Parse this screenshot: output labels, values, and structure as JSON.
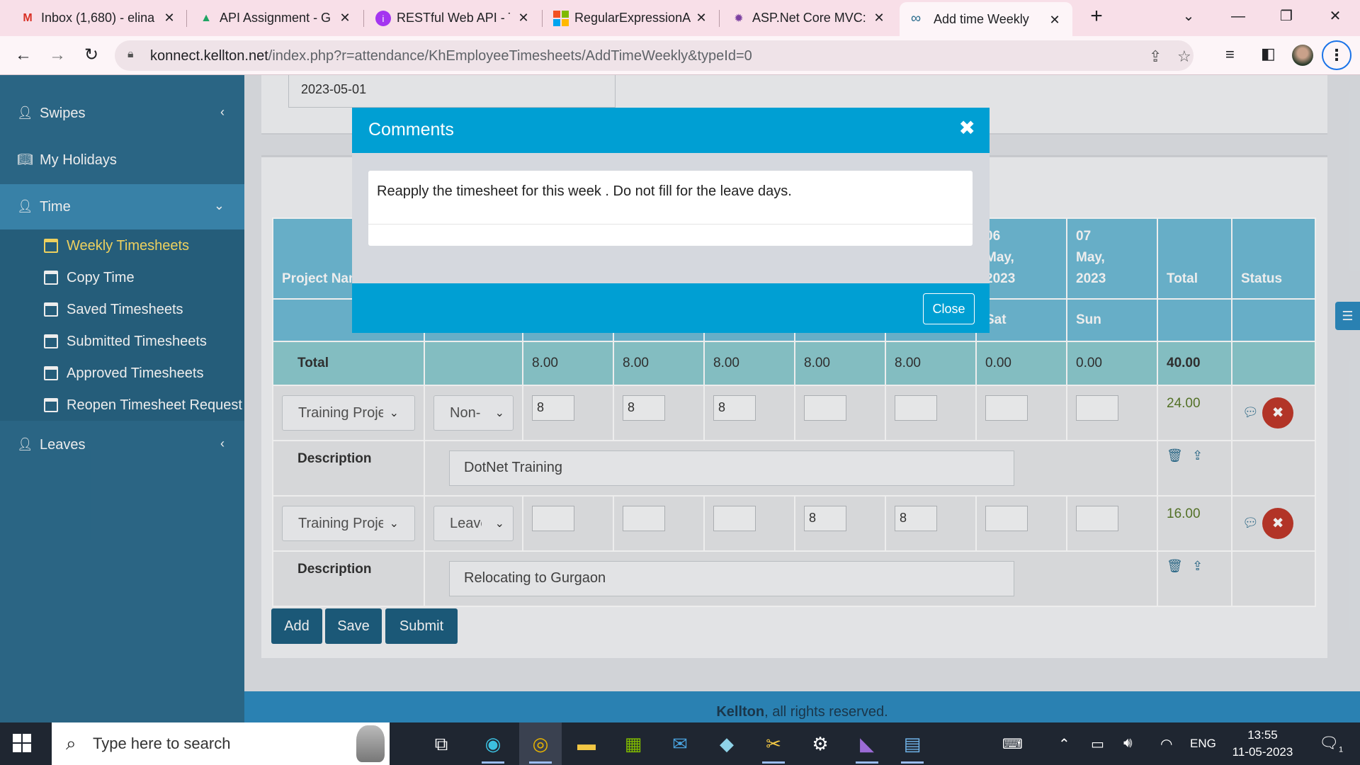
{
  "browser": {
    "tabs": [
      {
        "label": "Inbox (1,680) - elina",
        "icon": "gmail-icon",
        "icon_glyph": "M",
        "icon_color": "#d93025"
      },
      {
        "label": "API Assignment - G",
        "icon": "drive-icon",
        "icon_glyph": "▲",
        "icon_color": "#1fa463"
      },
      {
        "label": "RESTful Web API - T",
        "icon": "udemy-icon",
        "icon_glyph": "ⓘ",
        "icon_color": "#a435f0"
      },
      {
        "label": "RegularExpressionA",
        "icon": "microsoft-icon",
        "icon_glyph": "■",
        "icon_color": "#f25022"
      },
      {
        "label": "ASP.Net Core MVC:",
        "icon": "gear-site-icon",
        "icon_glyph": "✹",
        "icon_color": "#7b3fa0"
      },
      {
        "label": "Add time Weekly",
        "icon": "link-icon",
        "icon_glyph": "∞",
        "icon_color": "#2b6d8e"
      }
    ],
    "new_tab": "+",
    "url_domain": "konnect.kellton.net",
    "url_path": "/index.php?r=attendance/KhEmployeeTimesheets/AddTimeWeekly&typeId=0"
  },
  "sidebar": {
    "items": [
      {
        "label": "Swipes"
      },
      {
        "label": "My Holidays"
      },
      {
        "label": "Time"
      },
      {
        "label": "Leaves"
      }
    ],
    "sub_items": [
      {
        "label": "Weekly Timesheets"
      },
      {
        "label": "Copy Time"
      },
      {
        "label": "Saved Timesheets"
      },
      {
        "label": "Submitted Timesheets"
      },
      {
        "label": "Approved Timesheets"
      },
      {
        "label": "Reopen Timesheet Request"
      }
    ]
  },
  "form": {
    "week_start": "2023-05-01"
  },
  "table": {
    "header_project": "Project Name",
    "col6_header": [
      "06",
      "May,",
      "2023"
    ],
    "col7_header": [
      "07",
      "May,",
      "2023"
    ],
    "header_total": "Total",
    "header_status": "Status",
    "day_sat": "Sat",
    "day_sun": "Sun",
    "total_label": "Total",
    "totals": [
      "8.00",
      "8.00",
      "8.00",
      "8.00",
      "8.00",
      "0.00",
      "0.00",
      "40.00"
    ],
    "description_label": "Description",
    "rows": [
      {
        "project": "Training Project",
        "task": "Non-",
        "hours": [
          "8",
          "8",
          "8",
          "",
          "",
          "",
          ""
        ],
        "total": "24.00",
        "description": "DotNet Training"
      },
      {
        "project": "Training Project",
        "task": "Leave",
        "hours": [
          "",
          "",
          "",
          "8",
          "8",
          "",
          ""
        ],
        "total": "16.00",
        "description": "Relocating to Gurgaon"
      }
    ]
  },
  "actions": {
    "add": "Add",
    "save": "Save",
    "submit": "Submit"
  },
  "footer": {
    "brand": "Kellton",
    "text": ", all rights reserved."
  },
  "modal": {
    "title": "Comments",
    "body": "Reapply the timesheet for this week . Do not fill for the leave days.",
    "close_label": "Close"
  },
  "taskbar": {
    "search_placeholder": "Type here to search",
    "language": "ENG",
    "time": "13:55",
    "date": "11-05-2023",
    "notifications": "1"
  }
}
